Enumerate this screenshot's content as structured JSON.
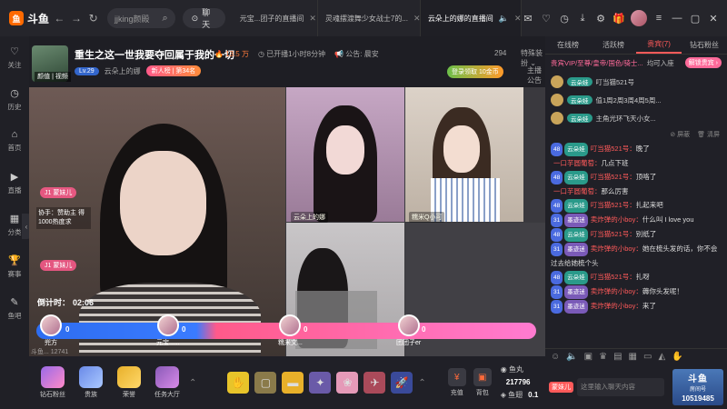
{
  "topbar": {
    "logo_text": "斗鱼",
    "search_value": "jjking颜殿",
    "chat_btn": "聊天",
    "tabs": [
      {
        "label": "元宝...团子的直播间"
      },
      {
        "label": "灵魂摆渡舞少女战士7的..."
      },
      {
        "label": "云朵上的娜的直播间"
      }
    ]
  },
  "rail": {
    "items": [
      {
        "label": "关注",
        "icon": "♡"
      },
      {
        "label": "历史",
        "icon": "◷"
      },
      {
        "label": "首页",
        "icon": "⌂"
      },
      {
        "label": "直播",
        "icon": "▶"
      },
      {
        "label": "分类",
        "icon": "▦"
      },
      {
        "label": "赛事",
        "icon": "🏆"
      },
      {
        "label": "鱼吧",
        "icon": "✎"
      }
    ],
    "collapse": "‹"
  },
  "room": {
    "host_badge": "颜值 | 视频",
    "title": "重生之这一世我要夺回属于我的一切",
    "hot": "13.5 万",
    "live_time": "已开播1小时8分钟",
    "announce": "公告: 晨安",
    "level": "Lv.29",
    "follow_name": "云朵上的娜",
    "rank_label": "新人榜",
    "rank_pos": "第34名",
    "viewers": "294",
    "special": "特殊装扮 ⌄",
    "login_reward": "登录领取 10金币",
    "notice": "主播公告"
  },
  "video": {
    "overlay_tag": "J1 蒙妹儿",
    "overlay_text": "协手：赞助主 得1000热度求",
    "overlay_tag2": "J1 蒙妹儿",
    "countdown_label": "倒计时：",
    "countdown_value": "02:06",
    "cam_label1": "云朵上的娜",
    "cam_label2": "糯米Q小可",
    "pk": {
      "seats": [
        {
          "name": "兜方",
          "score": "0"
        },
        {
          "name": "元宝......",
          "score": "0"
        },
        {
          "name": "糯米文...",
          "score": "0"
        },
        {
          "name": "团团子er",
          "score": "0"
        }
      ]
    },
    "bottom_faint": "斗鱼... 12741"
  },
  "giftbar": {
    "left": [
      {
        "label": "钻石粉丝"
      },
      {
        "label": "贵族"
      },
      {
        "label": "荣誉"
      },
      {
        "label": "任务大厅"
      }
    ],
    "recharge_label": "充值",
    "backpack_label": "背包",
    "balance_fish_label": "鱼丸",
    "balance_fish": "217796",
    "balance_coin_label": "鱼翅",
    "balance_coin": "0.1"
  },
  "right": {
    "tabs": [
      {
        "label": "在线榜"
      },
      {
        "label": "活跃榜"
      },
      {
        "label": "贵宾(7)"
      },
      {
        "label": "钻石粉丝"
      }
    ],
    "vip_left": "贵宾VIP/至尊/皇帝/国色/骑士...",
    "vip_mid": "均可入座",
    "vip_unlock": "解锁贵宾 ›",
    "fans": [
      {
        "tag": "云朵娃",
        "text": "叮当猫521号"
      },
      {
        "tag": "云朵娃",
        "text": "值1周2周3周4周5周..."
      },
      {
        "tag": "云朵娃",
        "text": "主角光环飞天小女..."
      }
    ],
    "tools": [
      "屏蔽",
      "清屏"
    ],
    "messages": [
      {
        "lv": "48",
        "fan": "云朵娃",
        "user": "叮当猫521号：",
        "text": "晚了"
      },
      {
        "lv": "",
        "fan": "",
        "user": "一口芋圆葡萄：",
        "text": "几点下班"
      },
      {
        "lv": "48",
        "fan": "云朵娃",
        "user": "叮当猫521号：",
        "text": "顶咯了"
      },
      {
        "lv": "",
        "fan": "",
        "user": "一口芋圆葡萄：",
        "text": "那么厉害"
      },
      {
        "lv": "48",
        "fan": "云朵娃",
        "user": "叮当猫521号：",
        "text": "扎起来吧"
      },
      {
        "lv": "31",
        "fan": "墨迹迷",
        "user": "卖炸弹的小boy：",
        "text": "什么叫 I love you"
      },
      {
        "lv": "48",
        "fan": "云朵娃",
        "user": "叮当猫521号：",
        "text": "别纸了"
      },
      {
        "lv": "31",
        "fan": "墨迹迷",
        "user": "卖炸弹的小boy：",
        "text": "她在梳头发的话，你不会过去给她梳个头"
      },
      {
        "lv": "48",
        "fan": "云朵娃",
        "user": "叮当猫521号：",
        "text": "扎呀"
      },
      {
        "lv": "31",
        "fan": "墨迹迷",
        "user": "卖炸弹的小boy：",
        "text": "薅你头发呢！"
      },
      {
        "lv": "31",
        "fan": "墨迹迷",
        "user": "卖炸弹的小boy：",
        "text": "来了"
      }
    ],
    "input_who": "蒙妹儿",
    "input_placeholder": "这里输入聊天内容",
    "send_big": "斗鱼",
    "send_sub": "房间号",
    "room_no": "10519485"
  }
}
